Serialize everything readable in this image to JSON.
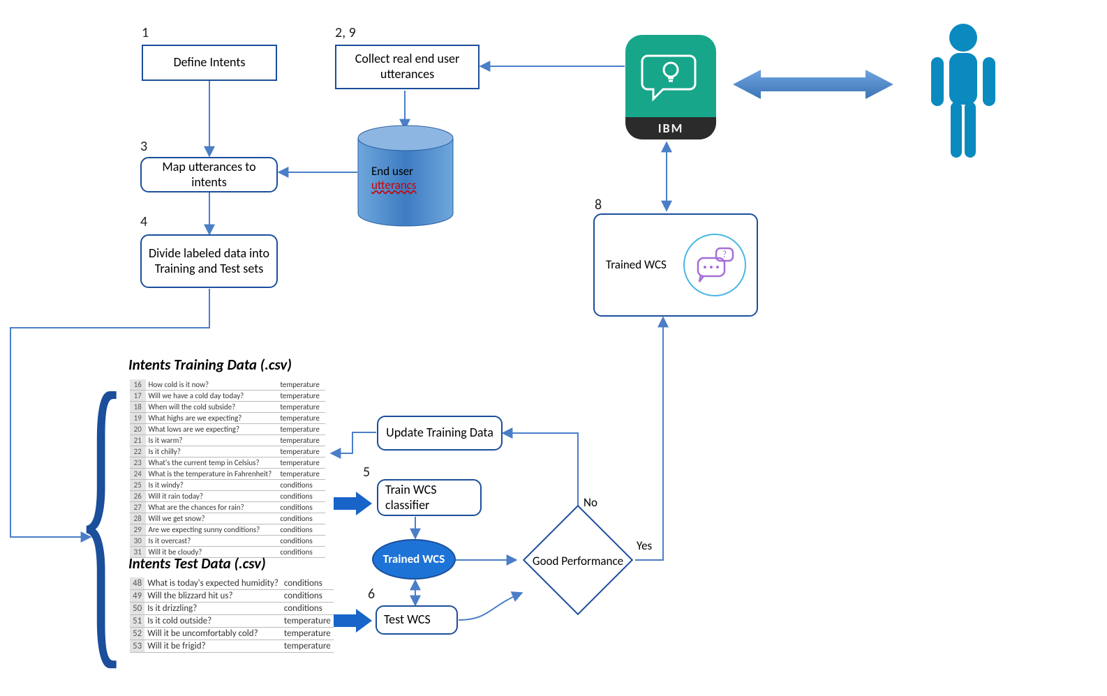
{
  "steps": {
    "s1_num": "1",
    "s1": "Define Intents",
    "s2_num": "2, 9",
    "s2": "Collect real end user utterances",
    "s3_num": "3",
    "s3": "Map utterances to intents",
    "s4_num": "4",
    "s4": "Divide labeled data into Training and Test sets",
    "s5_num": "5",
    "s5": "Train WCS classifier",
    "s6_num": "6",
    "s6": "Test WCS",
    "s8_num": "8",
    "s8": "Trained WCS",
    "update": "Update Training Data",
    "trained_ellipse": "Trained WCS"
  },
  "cylinder": {
    "l1": "End user",
    "l2": "utterancs"
  },
  "diamond": "Good Performance",
  "edge": {
    "no": "No",
    "yes": "Yes"
  },
  "titles": {
    "train": "Intents Training Data (.csv)",
    "test": "Intents Test Data (.csv)"
  },
  "ibm": "IBM",
  "train_rows": [
    {
      "n": "16",
      "u": "How cold is it now?",
      "c": "temperature"
    },
    {
      "n": "17",
      "u": "Will we have a cold day today?",
      "c": "temperature"
    },
    {
      "n": "18",
      "u": "When will the cold subside?",
      "c": "temperature"
    },
    {
      "n": "19",
      "u": "What highs are we expecting?",
      "c": "temperature"
    },
    {
      "n": "20",
      "u": "What lows are we expecting?",
      "c": "temperature"
    },
    {
      "n": "21",
      "u": "Is it warm?",
      "c": "temperature"
    },
    {
      "n": "22",
      "u": "Is it chilly?",
      "c": "temperature"
    },
    {
      "n": "23",
      "u": "What's the current temp in Celsius?",
      "c": "temperature"
    },
    {
      "n": "24",
      "u": "What is the temperature in Fahrenheit?",
      "c": "temperature"
    },
    {
      "n": "25",
      "u": "Is it windy?",
      "c": "conditions"
    },
    {
      "n": "26",
      "u": "Will it rain today?",
      "c": "conditions"
    },
    {
      "n": "27",
      "u": "What are the chances for rain?",
      "c": "conditions"
    },
    {
      "n": "28",
      "u": "Will we get snow?",
      "c": "conditions"
    },
    {
      "n": "29",
      "u": "Are we expecting sunny conditions?",
      "c": "conditions"
    },
    {
      "n": "30",
      "u": "Is it overcast?",
      "c": "conditions"
    },
    {
      "n": "31",
      "u": "Will it be cloudy?",
      "c": "conditions"
    }
  ],
  "test_rows": [
    {
      "n": "48",
      "u": "What is today's expected humidity?",
      "c": "conditions"
    },
    {
      "n": "49",
      "u": "Will the blizzard hit us?",
      "c": "conditions"
    },
    {
      "n": "50",
      "u": "Is it drizzling?",
      "c": "conditions"
    },
    {
      "n": "51",
      "u": "Is it cold outside?",
      "c": "temperature"
    },
    {
      "n": "52",
      "u": "Will it be uncomfortably cold?",
      "c": "temperature"
    },
    {
      "n": "53",
      "u": "Will it be frigid?",
      "c": "temperature"
    }
  ]
}
